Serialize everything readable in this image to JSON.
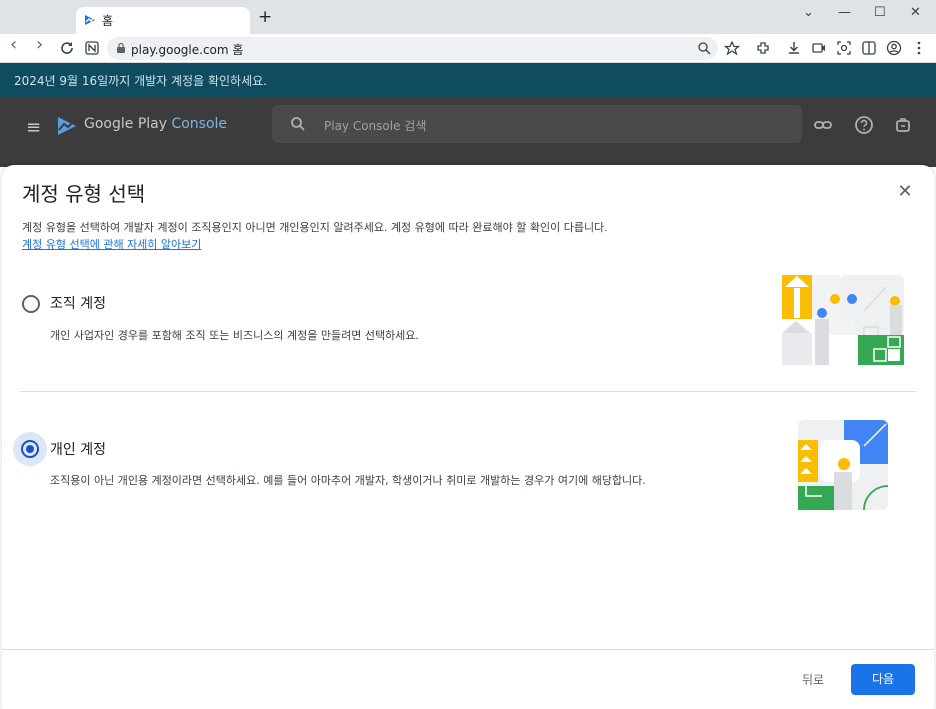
{
  "browser": {
    "tab_title": "홈",
    "new_tab": "+",
    "url": "play.google.com 홈",
    "controls": {
      "minimize": "—",
      "maximize": "☐",
      "close": "✕",
      "tab_list": "⌄"
    },
    "nav": {
      "back": "‹",
      "forward": "›"
    }
  },
  "banner": {
    "text": "2024년 9월 16일까지 개발자 계정을 확인하세요."
  },
  "appbar": {
    "brand": "Google Play",
    "brand_accent": "Console",
    "search_placeholder": "Play Console 검색"
  },
  "dialog": {
    "title": "계정 유형 선택",
    "description": "계정 유형을 선택하여 개발자 계정이 조직용인지 아니면 개인용인지 알려주세요. 계정 유형에 따라 완료해야 할 확인이 다릅니다.",
    "learn_more": "계정 유형 선택에 관해 자세히 알아보기",
    "options": [
      {
        "label": "조직 계정",
        "description": "개인 사업자인 경우를 포함해 조직 또는 비즈니스의 계정을 만들려면 선택하세요.",
        "selected": false
      },
      {
        "label": "개인 계정",
        "description": "조직용이 아닌 개인용 계정이라면 선택하세요. 예를 들어 아마추어 개발자, 학생이거나 취미로 개발하는 경우가 여기에 해당합니다.",
        "selected": true
      }
    ],
    "back_button": "뒤로",
    "next_button": "다음"
  },
  "colors": {
    "primary": "#1a73e8",
    "radio_selected": "#1a52c5",
    "banner_bg": "#0f4c5f",
    "illus_yellow": "#fbbc04",
    "illus_green": "#34a853",
    "illus_blue": "#4285f4"
  }
}
